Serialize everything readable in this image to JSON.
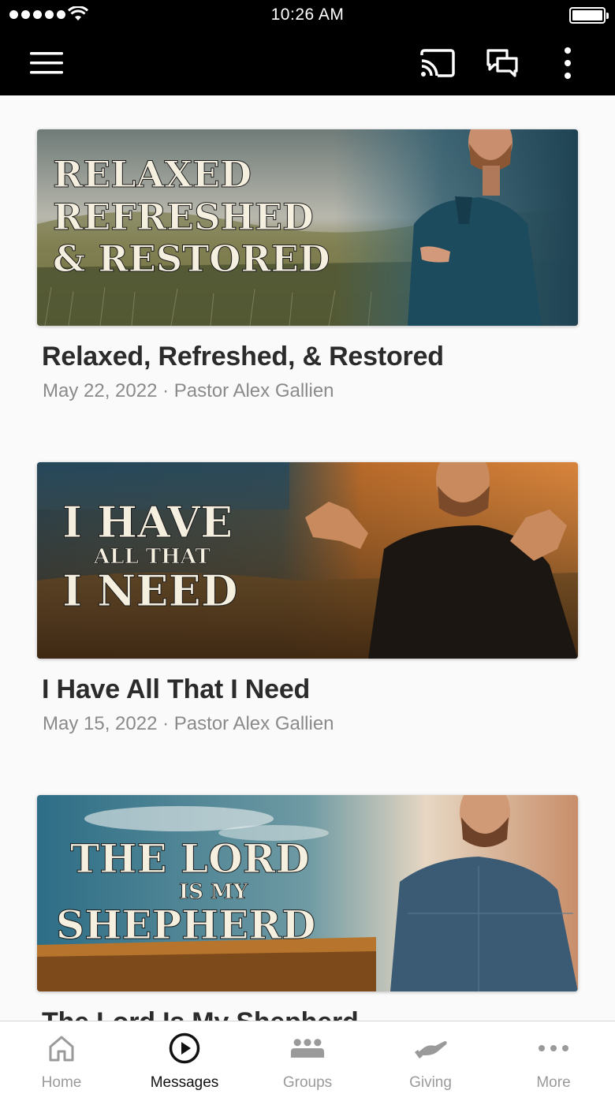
{
  "status_bar": {
    "time": "10:26 AM"
  },
  "header": {
    "menu_icon": "hamburger-menu-icon",
    "actions": [
      "cast-icon",
      "chat-bubbles-icon",
      "vertical-dots-icon"
    ]
  },
  "messages": [
    {
      "title": "Relaxed, Refreshed, & Restored",
      "meta": "May 22, 2022 · Pastor Alex Gallien",
      "art": {
        "line1": "RELAXED",
        "line2": "REFRESHED",
        "line3": "& RESTORED"
      }
    },
    {
      "title": "I Have All That I Need",
      "meta": "May 15, 2022 · Pastor Alex Gallien",
      "art": {
        "line1": "I HAVE",
        "line2": "ALL THAT",
        "line3": "I NEED"
      }
    },
    {
      "title": "The Lord Is My Shepherd",
      "meta": "",
      "art": {
        "line1": "THE LORD",
        "line2": "IS MY",
        "line3": "SHEPHERD"
      }
    }
  ],
  "tabs": [
    {
      "label": "Home",
      "icon": "home-icon",
      "active": false
    },
    {
      "label": "Messages",
      "icon": "play-circle-icon",
      "active": true
    },
    {
      "label": "Groups",
      "icon": "groups-icon",
      "active": false
    },
    {
      "label": "Giving",
      "icon": "giving-hand-icon",
      "active": false
    },
    {
      "label": "More",
      "icon": "more-dots-icon",
      "active": false
    }
  ],
  "colors": {
    "top_bar": "#000000",
    "background": "#fafafa",
    "title_text": "#2b2b2b",
    "meta_text": "#8a8a8a",
    "tab_inactive": "#9a9a9a",
    "tab_active": "#111111"
  }
}
